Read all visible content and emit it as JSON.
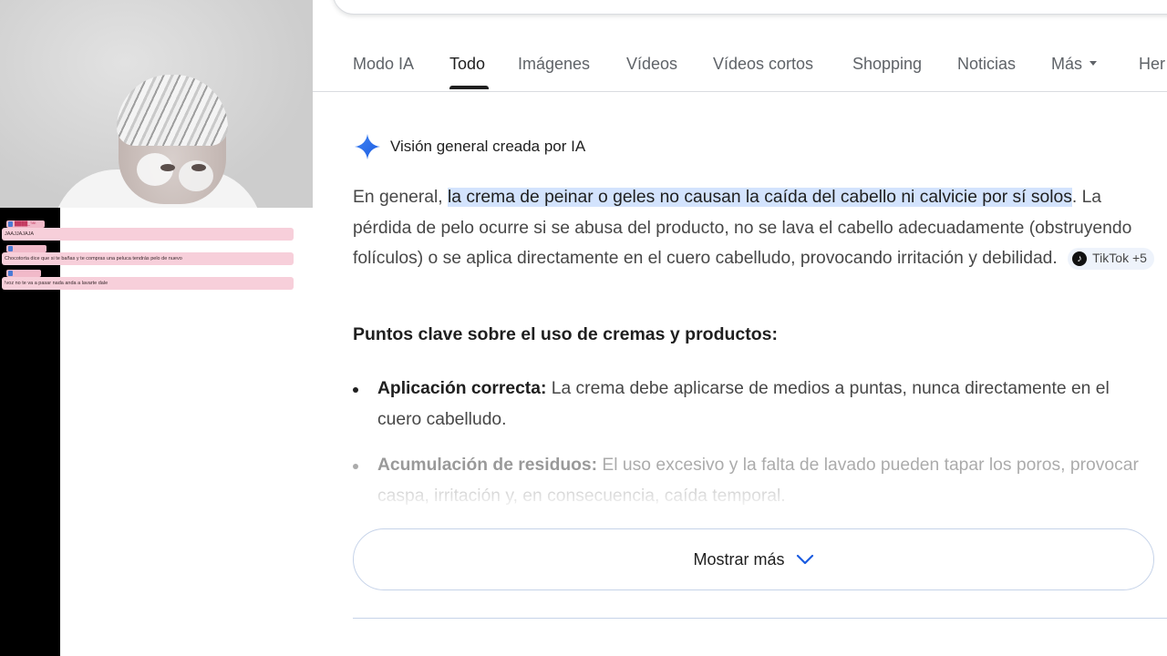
{
  "stream": {
    "chat": [
      {
        "user": "████_ᵀᴬᴷ",
        "text": "JAAJJAJAJA"
      },
      {
        "user": "",
        "text": "Chocotorta dice que si te bañas y te compras una peluca tendrás pelo de nuevo"
      },
      {
        "user": "",
        "text": "!voz no te va a pasar nada anda a lavarte dale"
      }
    ]
  },
  "tabs": [
    {
      "label": "Modo IA"
    },
    {
      "label": "Todo",
      "active": true
    },
    {
      "label": "Imágenes"
    },
    {
      "label": "Vídeos"
    },
    {
      "label": "Vídeos cortos"
    },
    {
      "label": "Shopping"
    },
    {
      "label": "Noticias"
    },
    {
      "label": "Más"
    },
    {
      "label": "Her"
    }
  ],
  "ai_overview": {
    "title": "Visión general creada por IA",
    "intro": "En general, ",
    "highlight": "la crema de peinar o geles no causan la caída del cabello ni calvicie por sí solos",
    "rest": ". La pérdida de pelo ocurre si se abusa del producto, no se lava el cabello adecuadamente (obstruyendo folículos) o se aplica directamente en el cuero cabelludo, provocando irritación y debilidad.",
    "source_chip": "TikTok +5",
    "key_points_heading": "Puntos clave sobre el uso de cremas y productos:",
    "bullets": [
      {
        "title": "Aplicación correcta:",
        "text": " La crema debe aplicarse de medios a puntas, nunca directamente en el cuero cabelludo."
      },
      {
        "title": "Acumulación de residuos:",
        "text": " El uso excesivo y la falta de lavado pueden tapar los poros, provocar caspa, irritación y, en consecuencia, caída temporal."
      }
    ],
    "show_more": "Mostrar más"
  },
  "colors": {
    "accent_blue": "#4285f4",
    "highlight": "#d3e3fd"
  }
}
